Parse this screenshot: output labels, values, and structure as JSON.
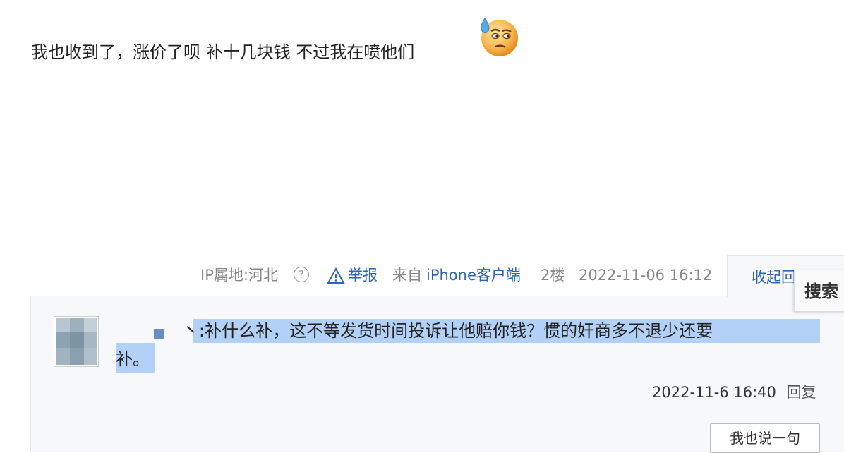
{
  "post": {
    "text": "我也收到了，涨价了呗 补十几块钱 不过我在喷他们"
  },
  "meta": {
    "ip": "IP属地:河北",
    "help": "?",
    "report": "举报",
    "source_prefix": "来自",
    "source_client": "iPhone客户端",
    "floor": "2楼",
    "datetime": "2022-11-06 16:12"
  },
  "collapse": {
    "label": "收起回复"
  },
  "search": {
    "label": "搜索"
  },
  "reply": {
    "user_suffix": "丶:",
    "text_line1": "补什么补，这不等发货时间投诉让他赔你钱？惯的奸商多不退少还要",
    "text_line2": "补。",
    "time": "2022-11-6 16:40",
    "reply_label": "回复"
  },
  "say_button": {
    "label": "我也说一句"
  }
}
